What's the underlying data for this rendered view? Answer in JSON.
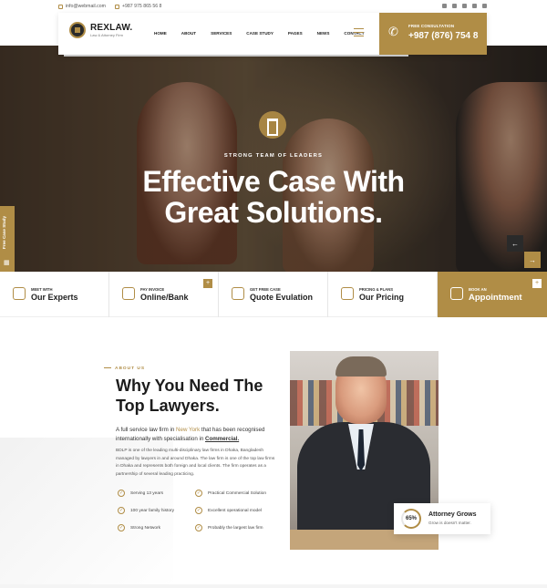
{
  "topbar": {
    "email": "info@webmail.com",
    "phone": "+987 975 865 56 8",
    "social_icons": [
      "facebook-icon",
      "twitter-icon",
      "skype-icon",
      "linkedin-icon",
      "youtube-icon"
    ]
  },
  "header": {
    "logo_name": "REXLAW.",
    "logo_tagline": "Law & Attorney Firm",
    "nav": [
      "HOME",
      "ABOUT",
      "SERVICES",
      "CASE STUDY",
      "PAGES",
      "NEWS",
      "CONTACT"
    ],
    "consult_label": "FREE CONSULTATION",
    "consult_phone": "+987 (876) 754 8",
    "accent": "#b08d46"
  },
  "hero": {
    "subtitle": "STRONG TEAM OF LEADERS",
    "title_line1": "Effective Case With",
    "title_line2": "Great Solutions.",
    "side_tab": "Free Case Study"
  },
  "services": [
    {
      "small": "MEET WITH",
      "big": "Our Experts",
      "icon": "experts-icon",
      "plus": false
    },
    {
      "small": "PAY INVOICE",
      "big": "Online/Bank",
      "icon": "invoice-icon",
      "plus": true
    },
    {
      "small": "GET FREE CASE",
      "big": "Quote Evulation",
      "icon": "quote-icon",
      "plus": false
    },
    {
      "small": "PRICING & PLANS",
      "big": "Our Pricing",
      "icon": "cart-icon",
      "plus": false
    },
    {
      "small": "BOOK AN",
      "big": "Appointment",
      "icon": "calendar-icon",
      "plus": true
    }
  ],
  "about": {
    "label": "ABOUT US",
    "title_line1": "Why You Need The",
    "title_line2": "Top Lawyers.",
    "lead_pre": "A full service law firm in ",
    "lead_city": "New York",
    "lead_mid": " that has been recognised internationally with specialisation in ",
    "lead_spec": "Commercial.",
    "body": "BDLP is one of the leading multi-disciplinary law firms in Dhaka, Bangladesh managed by lawyers in and around Dhaka. The law firm is one of the top law firms in Dhaka and represents both foreign and local clients. The firm operates as a partnership of several leading practicing.",
    "features": [
      "Serving 13 years",
      "Practical Commercial Solution",
      "100 year family history",
      "Excellent operational model",
      "Strong Network",
      "Probably the largest law firm"
    ]
  },
  "grow_card": {
    "percent": "65%",
    "title": "Attorney Grows",
    "subtitle": "Grow is doesn't matter."
  }
}
